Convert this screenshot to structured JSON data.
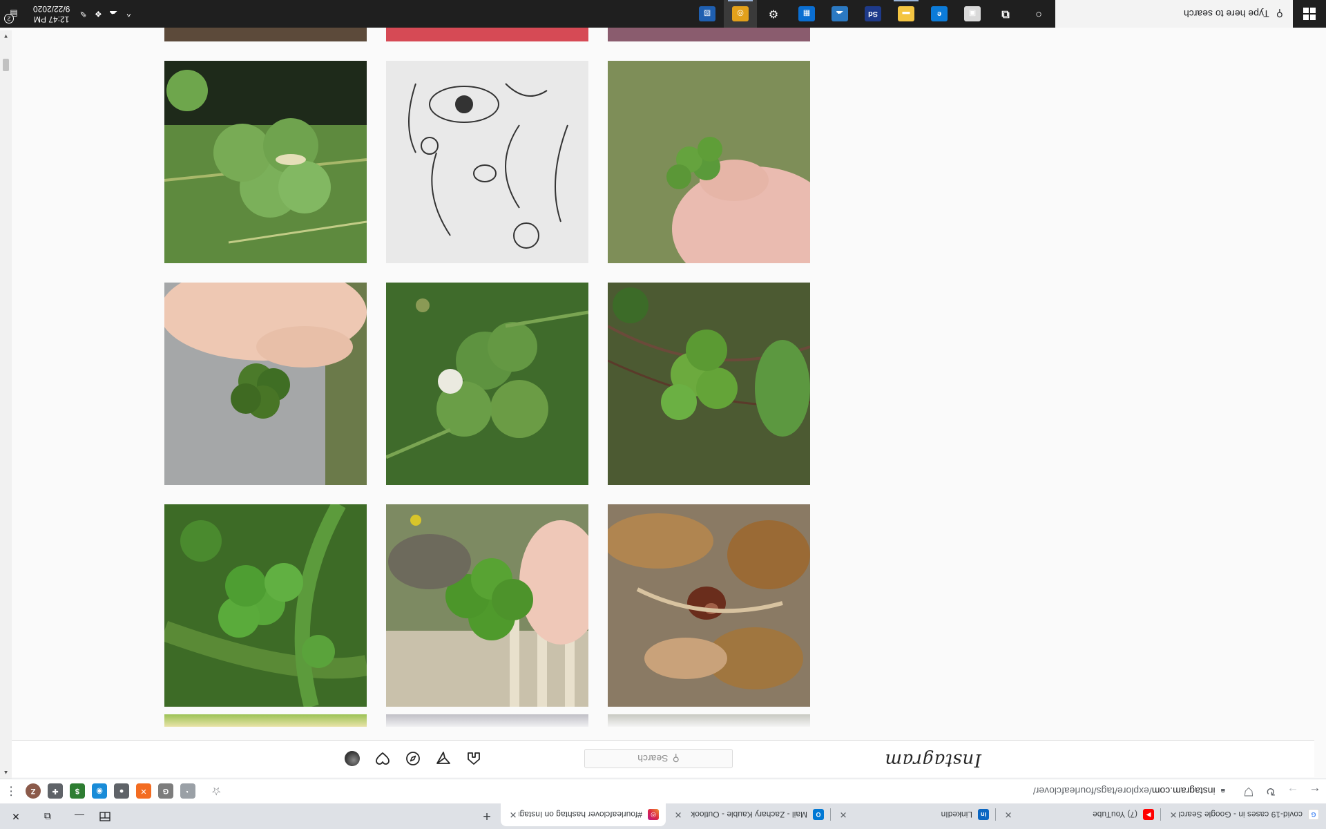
{
  "browser": {
    "tabs": [
      {
        "title": "covid-19 cases in - Google Search",
        "favicon": "google-icon",
        "color": "#ffffff",
        "active": false
      },
      {
        "title": "(7) YouTube",
        "favicon": "youtube-icon",
        "color": "#ff0000",
        "active": false
      },
      {
        "title": "LinkedIn",
        "favicon": "linkedin-icon",
        "color": "#0a66c2",
        "active": false
      },
      {
        "title": "Mail - Zachary Kauble - Outlook",
        "favicon": "outlook-icon",
        "color": "#0078d4",
        "active": false
      },
      {
        "title": "#fourleafclover hashtag on Instagram",
        "favicon": "instagram-icon",
        "color": "#d6249f",
        "active": true
      }
    ],
    "new_tab_label": "+",
    "url_host": "instagram.com",
    "url_path": "/explore/tags/fourleafclover/",
    "extensions": [
      {
        "name": "hat-extension-icon",
        "glyph": "◔",
        "color": "#9aa0a6"
      },
      {
        "name": "g-extension-icon",
        "glyph": "G",
        "color": "#7d7d7d"
      },
      {
        "name": "orange-x-extension-icon",
        "glyph": "✕",
        "color": "#f36c21"
      },
      {
        "name": "circle-extension-icon",
        "glyph": "●",
        "color": "#5f6368"
      },
      {
        "name": "blue-extension-icon",
        "glyph": "◉",
        "color": "#1a8cd8"
      },
      {
        "name": "green-extension-icon",
        "glyph": "$",
        "color": "#2e7d32"
      },
      {
        "name": "puzzle-icon",
        "glyph": "✚",
        "color": "#5f6368"
      }
    ],
    "profile_initial": "Z",
    "profile_color": "#8b5a4a"
  },
  "instagram": {
    "logo": "Instagram",
    "search_placeholder": "Search",
    "posts": [
      {
        "label": "Post 1",
        "desc": "clover-in-grass"
      },
      {
        "label": "Post 2",
        "desc": "sketch-drawing"
      },
      {
        "label": "Post 3",
        "desc": "hand-holding-clover"
      },
      {
        "label": "Post 4",
        "desc": "hand-with-clover-gray"
      },
      {
        "label": "Post 5",
        "desc": "clover-white-flower"
      },
      {
        "label": "Post 6",
        "desc": "clover-weeds"
      },
      {
        "label": "Post 7",
        "desc": "clover-dandelion"
      },
      {
        "label": "Post 8",
        "desc": "clover-on-bench"
      },
      {
        "label": "Post 9",
        "desc": "chestnut-leaves"
      }
    ]
  },
  "taskbar": {
    "search_placeholder": "Type here to search",
    "apps": [
      {
        "name": "cortana-icon",
        "glyph": "○",
        "color": "transparent",
        "running": false
      },
      {
        "name": "task-view-icon",
        "glyph": "⧉",
        "color": "transparent",
        "running": false
      },
      {
        "name": "office-icon",
        "glyph": "▣",
        "color": "#d9d9d9",
        "running": false
      },
      {
        "name": "edge-icon",
        "glyph": "e",
        "color": "#0c7bd8",
        "running": false
      },
      {
        "name": "file-explorer-icon",
        "glyph": "▬",
        "color": "#f4c542",
        "running": true
      },
      {
        "name": "photoshop-express-icon",
        "glyph": "Sd",
        "color": "#1e3a8a",
        "running": false
      },
      {
        "name": "onedrive-icon",
        "glyph": "☁",
        "color": "#2b79c2",
        "running": false
      },
      {
        "name": "outlook-taskbar-icon",
        "glyph": "▦",
        "color": "#0a6ed1",
        "running": false
      },
      {
        "name": "settings-icon",
        "glyph": "⚙",
        "color": "transparent",
        "running": false
      },
      {
        "name": "chrome-icon",
        "glyph": "◎",
        "color": "#e2a01b",
        "running": true,
        "active": true
      },
      {
        "name": "photos-icon",
        "glyph": "▨",
        "color": "#1f5fb0",
        "running": false
      }
    ],
    "time": "12:47 PM",
    "date": "9/22/2020",
    "notification_count": "2"
  }
}
